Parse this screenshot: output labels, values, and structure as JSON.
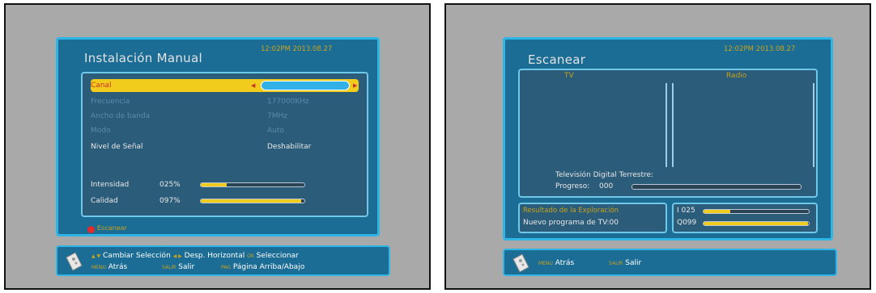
{
  "left": {
    "title": "Instalación Manual",
    "clock": "12:02PM  2013.08.27",
    "rows": [
      {
        "label": "Canal",
        "value": "",
        "selected": true
      },
      {
        "label": "Frecuencia",
        "value": "177000KHz",
        "dim": true
      },
      {
        "label": "Ancho de banda",
        "value": "7MHz",
        "dim": true
      },
      {
        "label": "Modo",
        "value": "Auto",
        "dim": true
      },
      {
        "label": "Nivel de Señal",
        "value": "Deshabilitar"
      }
    ],
    "intensity_label": "Intensidad",
    "intensity_value": "025%",
    "intensity": 0.25,
    "quality_label": "Calidad",
    "quality_value": "097%",
    "quality": 0.97,
    "scan_label": "Escanear",
    "footer": {
      "change": "Cambiar Selección",
      "h_scroll": "Desp. Horizontal",
      "ok_key": "OK",
      "select": "Seleccionar",
      "menu_key": "MENU",
      "back": "Atrás",
      "exit_key": "SALIR",
      "exit": "Salir",
      "pag_key": "PAG",
      "page": "Página Arriba/Abajo"
    }
  },
  "right": {
    "title": "Escanear",
    "clock": "12:02PM  2013.08.27",
    "tv_header": "TV",
    "radio_header": "Radio",
    "dtv_label": "Televisión Digital Terrestre:",
    "progress_label": "Progreso:",
    "progress_value": "000",
    "progress": 0.0,
    "result_label": "Resultado de la Exploración",
    "new_tv": "Nuevo programa de TV:00",
    "i_label": "I 025",
    "i_level": 0.25,
    "q_label": "Q099",
    "q_level": 0.99,
    "footer": {
      "menu_key": "MENU",
      "back": "Atrás",
      "exit_key": "SALIR",
      "exit": "Salir"
    }
  },
  "colors": {
    "panel": "#1c6d95",
    "border": "#2fb5e6",
    "highlight": "#f2cc1c",
    "meter_fill": "#f0cc1e",
    "title_accent": "#c7a21c"
  }
}
